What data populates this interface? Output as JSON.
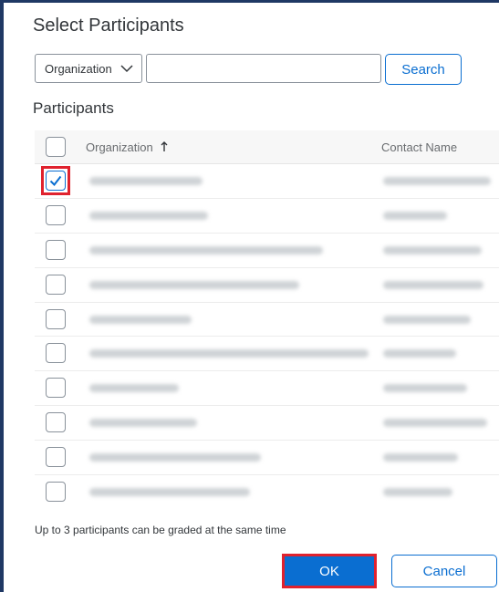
{
  "dialog": {
    "title": "Select Participants",
    "filter": {
      "selected": "Organization",
      "search_placeholder": "",
      "search_value": ""
    },
    "search_label": "Search",
    "section_label": "Participants",
    "table": {
      "headers": {
        "organization": "Organization",
        "sort_icon": "sort-ascending-icon",
        "contact": "Contact Name"
      },
      "rows": [
        {
          "checked": true
        },
        {
          "checked": false
        },
        {
          "checked": false
        },
        {
          "checked": false
        },
        {
          "checked": false
        },
        {
          "checked": false
        },
        {
          "checked": false
        },
        {
          "checked": false
        },
        {
          "checked": false
        },
        {
          "checked": false
        }
      ]
    },
    "footer_note": "Up to 3 participants can be graded at the same time",
    "ok_label": "OK",
    "cancel_label": "Cancel"
  },
  "colors": {
    "accent": "#0a6ed1",
    "highlight": "#e0222e",
    "frame": "#1f3864"
  }
}
